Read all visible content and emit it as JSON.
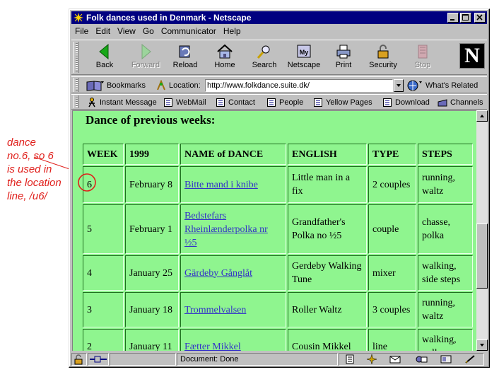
{
  "annotation": {
    "text": "dance no.6, so 6 is used in the location line, /u6/",
    "color": "#e0201c"
  },
  "window": {
    "title": "Folk dances used in Denmark - Netscape",
    "controls": [
      "minimize-icon",
      "maximize-icon",
      "close-icon"
    ]
  },
  "menu": [
    "File",
    "Edit",
    "View",
    "Go",
    "Communicator",
    "Help"
  ],
  "navigation": [
    {
      "label": "Back",
      "icon": "back-icon",
      "enabled": true
    },
    {
      "label": "Forward",
      "icon": "forward-icon",
      "enabled": false
    },
    {
      "label": "Reload",
      "icon": "reload-icon",
      "enabled": true
    },
    {
      "label": "Home",
      "icon": "home-icon",
      "enabled": true
    },
    {
      "label": "Search",
      "icon": "search-icon",
      "enabled": true
    },
    {
      "label": "Netscape",
      "icon": "netscape-icon",
      "enabled": true
    },
    {
      "label": "Print",
      "icon": "print-icon",
      "enabled": true
    },
    {
      "label": "Security",
      "icon": "security-icon",
      "enabled": true
    },
    {
      "label": "Stop",
      "icon": "stop-icon",
      "enabled": false
    }
  ],
  "logo": "N",
  "location": {
    "bookmarks": "Bookmarks",
    "label": "Location:",
    "url": "http://www.folkdance.suite.dk/",
    "whats_related": "What's Related"
  },
  "personal": [
    "Instant Message",
    "WebMail",
    "Contact",
    "People",
    "Yellow Pages",
    "Download",
    "Channels"
  ],
  "content": {
    "background": "#8ff58f",
    "heading": "Dance of previous weeks:",
    "columns": [
      "WEEK",
      "1999",
      "NAME of DANCE",
      "ENGLISH",
      "TYPE",
      "STEPS"
    ],
    "rows": [
      {
        "week": "6",
        "date": "February 8",
        "name": "Bitte mand i knibe ",
        "english": "Little man in a fix",
        "type": "2 couples",
        "steps": "running, waltz"
      },
      {
        "week": "5",
        "date": "February 1",
        "name": "Bedstefars Rheinlænderpolka nr ½5",
        "english": "Grandfather's Polka no ½5",
        "type": "couple",
        "steps": "chasse, polka"
      },
      {
        "week": "4",
        "date": "January 25",
        "name": "Gärdeby Gånglåt ",
        "english": "Gerdeby Walking Tune",
        "type": "mixer",
        "steps": "walking, side steps"
      },
      {
        "week": "3",
        "date": "January 18",
        "name": "Trommelvalsen",
        "english": "Roller Waltz",
        "type": "3 couples",
        "steps": "running, waltz"
      },
      {
        "week": "2",
        "date": "January 11",
        "name": "Fætter Mikkel",
        "english": "Cousin Mikkel",
        "type": "line",
        "steps": "walking, polka"
      }
    ]
  },
  "status": {
    "text": "Document: Done"
  }
}
